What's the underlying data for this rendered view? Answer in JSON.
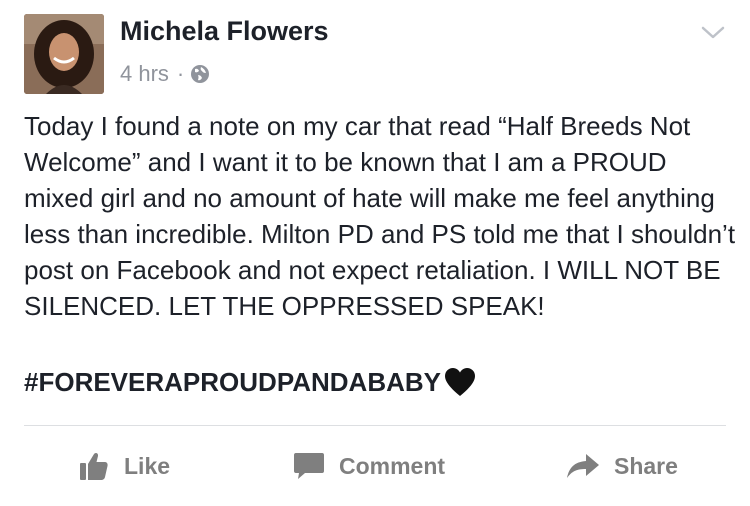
{
  "post": {
    "author": "Michela Flowers",
    "timestamp": "4 hrs",
    "separator": "·",
    "privacy_icon": "globe-icon",
    "options_icon": "chevron-down-icon",
    "body": "Today I found a note on my car that read “Half Breeds Not Welcome” and I want it to be known that I am a PROUD mixed girl and no amount of hate will make me feel anything less than incredible. Milton PD and PS told me that I shouldn’t post on Facebook and not expect retaliation. I WILL NOT BE SILENCED. LET THE OPPRESSED SPEAK!",
    "hashtag": "#FOREVERAPROUDPANDABABY",
    "emoji_icon": "black-heart-icon"
  },
  "actions": {
    "like_label": "Like",
    "comment_label": "Comment",
    "share_label": "Share"
  },
  "colors": {
    "text": "#1d2129",
    "meta": "#90949c",
    "action": "#7f7f7f",
    "divider": "#dddfe2"
  }
}
